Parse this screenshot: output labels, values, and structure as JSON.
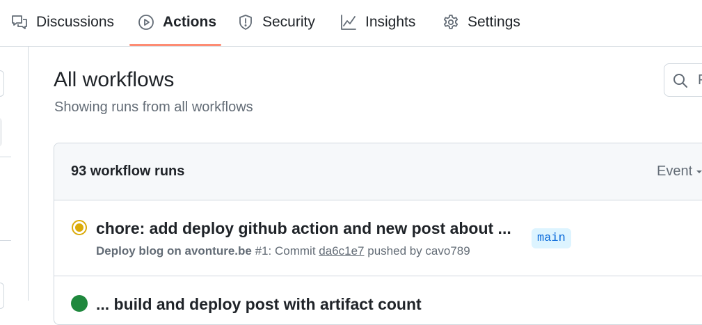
{
  "nav": {
    "tabs": [
      {
        "label": "Discussions",
        "icon": "discussions-icon"
      },
      {
        "label": "Actions",
        "icon": "play-icon",
        "active": true
      },
      {
        "label": "Security",
        "icon": "shield-icon"
      },
      {
        "label": "Insights",
        "icon": "graph-icon"
      },
      {
        "label": "Settings",
        "icon": "gear-icon"
      }
    ],
    "active_color": "#fd8c73"
  },
  "main": {
    "title": "All workflows",
    "subtitle": "Showing runs from all workflows",
    "search_placeholder": "F"
  },
  "runs": {
    "count_label": "93 workflow runs",
    "event_filter_label": "Event",
    "items": [
      {
        "status": "in-progress",
        "status_color": "#dbab0a",
        "title": "chore: add deploy github action and new post about ...",
        "workflow": "Deploy blog on avonture.be",
        "run_number": "#1",
        "commit_prefix": "Commit",
        "sha": "da6c1e7",
        "pushed_by": "pushed by cavo789",
        "branch": "main"
      },
      {
        "status": "success",
        "status_color": "#1f883d",
        "title": "... build and deploy post with artifact count"
      }
    ]
  }
}
